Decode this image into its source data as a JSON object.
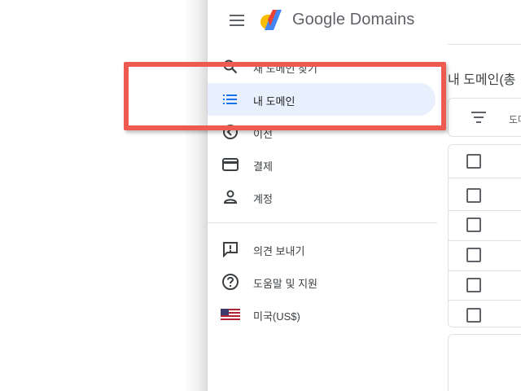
{
  "header": {
    "menu_icon": "hamburger-menu-icon",
    "brand_name": "Google Domains"
  },
  "nav": {
    "items": [
      {
        "label": "새 도메인 찾기",
        "icon": "search-icon"
      },
      {
        "label": "내 도메인",
        "icon": "list-icon",
        "active": true
      },
      {
        "label": "이전",
        "icon": "transfer-icon"
      },
      {
        "label": "결제",
        "icon": "credit-card-icon"
      },
      {
        "label": "계정",
        "icon": "person-icon"
      }
    ],
    "secondary": [
      {
        "label": "의견 보내기",
        "icon": "feedback-icon"
      },
      {
        "label": "도움말 및 지원",
        "icon": "help-icon"
      },
      {
        "label": "미국(US$)",
        "icon": "us-flag-icon"
      }
    ]
  },
  "main": {
    "title": "내 도메인(총",
    "filter_label": "도메",
    "rows": 6
  },
  "colors": {
    "active_bg": "#e8f0fe",
    "accent_blue": "#1a73e8",
    "annotation_red": "#ef5a50"
  }
}
